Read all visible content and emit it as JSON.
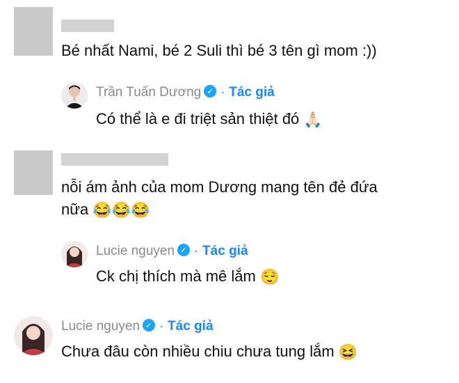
{
  "comments": [
    {
      "text": "Bé nhất Nami, bé 2 Suli thì bé 3 tên gì mom :))",
      "reply": {
        "name": "Trần Tuấn Dương",
        "badge_icon": "verified-check-icon",
        "author_label": "Tác giả",
        "text": "Có thể là e đi triệt sản thiệt đó",
        "emoji": "🙏🏻"
      }
    },
    {
      "text_line1": "nỗi ám ảnh của mom Dương mang tên đẻ đứa",
      "text_line2": "nữa",
      "emoji": "😂😂😂",
      "reply": {
        "name": "Lucie nguyen",
        "badge_icon": "verified-check-icon",
        "author_label": "Tác giả",
        "text": "Ck chị thích mà mê lắm",
        "emoji": "😌"
      }
    },
    {
      "name": "Lucie nguyen",
      "badge_icon": "verified-check-icon",
      "author_label": "Tác giả",
      "text": "Chưa đâu còn nhiều chiu chưa tung lắm",
      "emoji": "😆"
    }
  ],
  "colors": {
    "accent": "#1a86ff",
    "badge": "#1aa3ff",
    "name_gray": "#8a8a8a"
  }
}
